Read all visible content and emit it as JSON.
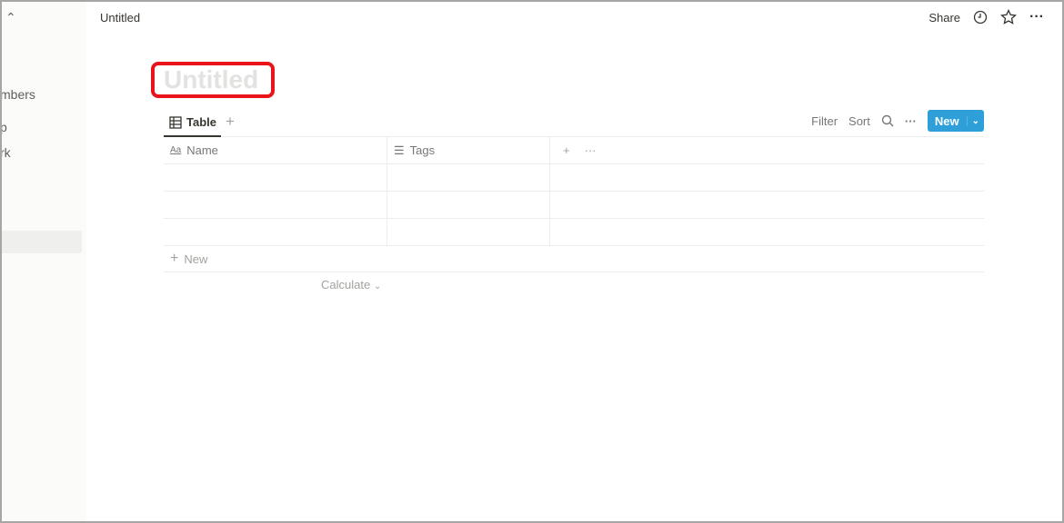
{
  "sidebar": {
    "items": [
      {
        "label": "mbers"
      },
      {
        "label": "p"
      },
      {
        "label": "rk"
      }
    ]
  },
  "topbar": {
    "breadcrumb": "Untitled",
    "share": "Share"
  },
  "page": {
    "title": "Untitled"
  },
  "view": {
    "tab": "Table",
    "filter": "Filter",
    "sort": "Sort",
    "new": "New"
  },
  "table": {
    "columns": [
      {
        "label": "Name",
        "icon": "Aa"
      },
      {
        "label": "Tags"
      }
    ],
    "rows": 3,
    "new_row": "New",
    "calculate": "Calculate"
  },
  "colors": {
    "accent": "#2e9fd8",
    "highlight": "#e8141a"
  }
}
